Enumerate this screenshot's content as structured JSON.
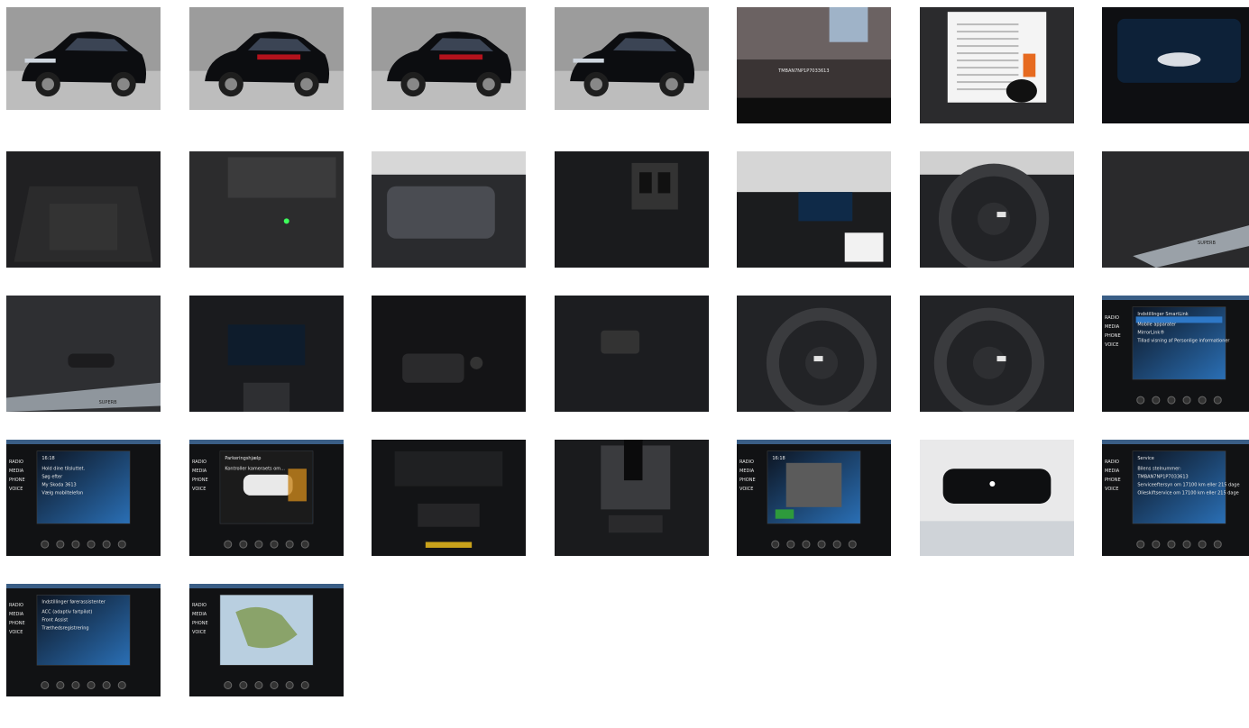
{
  "gallery": {
    "photos": [
      {
        "icon": "car-front-left-photo",
        "h": 114,
        "scene": "car-ext-fl"
      },
      {
        "icon": "car-rear-left-photo",
        "h": 114,
        "scene": "car-ext-rl"
      },
      {
        "icon": "car-rear-photo",
        "h": 114,
        "scene": "car-ext-r"
      },
      {
        "icon": "car-front-photo",
        "h": 114,
        "scene": "car-ext-f"
      },
      {
        "icon": "vin-plate-photo",
        "h": 129,
        "scene": "vin",
        "text": "TMBAN7NP1P7033613"
      },
      {
        "icon": "documents-and-keys-photo",
        "h": 129,
        "scene": "docs"
      },
      {
        "icon": "digital-cockpit-photo",
        "h": 129,
        "scene": "cockpit"
      },
      {
        "icon": "trunk-photo",
        "h": 129,
        "scene": "trunk"
      },
      {
        "icon": "trunk-sill-photo",
        "h": 129,
        "scene": "sill"
      },
      {
        "icon": "rear-seats-photo",
        "h": 129,
        "scene": "rearseat"
      },
      {
        "icon": "rear-vents-photo",
        "h": 129,
        "scene": "rearvent"
      },
      {
        "icon": "dashboard-photo",
        "h": 129,
        "scene": "dash"
      },
      {
        "icon": "steering-wheel-photo",
        "h": 129,
        "scene": "wheel"
      },
      {
        "icon": "door-sill-photo",
        "h": 129,
        "scene": "doorsill",
        "text": "SUPERB"
      },
      {
        "icon": "seat-controls-photo",
        "h": 129,
        "scene": "seatctl",
        "text": "SUPERB"
      },
      {
        "icon": "center-console-photo",
        "h": 129,
        "scene": "console"
      },
      {
        "icon": "window-switches-photo",
        "h": 129,
        "scene": "winsw"
      },
      {
        "icon": "light-switch-photo",
        "h": 129,
        "scene": "lightsw"
      },
      {
        "icon": "steering-left-buttons-photo",
        "h": 129,
        "scene": "wheelL"
      },
      {
        "icon": "steering-right-buttons-photo",
        "h": 129,
        "scene": "wheelR"
      },
      {
        "icon": "infotainment-smartlink-photo",
        "h": 129,
        "scene": "screen-smartlink",
        "screen": {
          "title": "Indstillinger SmartLink",
          "lines": [
            "Mobile apparater",
            "MirrorLink®",
            "Tillad visning af Personlige informationer"
          ]
        }
      },
      {
        "icon": "infotainment-phone-photo",
        "h": 129,
        "scene": "screen-phone",
        "screen": {
          "title": "16:18",
          "lines": [
            "Hold dine tilsluttet.",
            "Søg efter",
            "My Skoda 3613",
            "Vælg mobiltelefon"
          ]
        }
      },
      {
        "icon": "infotainment-parking-photo",
        "h": 129,
        "scene": "screen-park",
        "screen": {
          "title": "Parkeringshjælp",
          "lines": [
            "Kontroller kameraets om..."
          ]
        }
      },
      {
        "icon": "climate-controls-photo",
        "h": 129,
        "scene": "climate"
      },
      {
        "icon": "gear-selector-photo",
        "h": 129,
        "scene": "gear"
      },
      {
        "icon": "infotainment-car-photo",
        "h": 129,
        "scene": "screen-car",
        "screen": {
          "title": "16:18",
          "lines": []
        }
      },
      {
        "icon": "rear-view-mirror-photo",
        "h": 129,
        "scene": "mirror"
      },
      {
        "icon": "infotainment-service-photo",
        "h": 129,
        "scene": "screen-service",
        "screen": {
          "title": "Service",
          "lines": [
            "Bilens stelnummer:",
            "TMBAN7NP1P7033613",
            "Serviceeftersyn om 17100 km eller 215 dage",
            "Olieskiftservice om 17100 km eller 215 dage"
          ]
        }
      },
      {
        "icon": "infotainment-assist-photo",
        "h": 125,
        "scene": "screen-assist",
        "screen": {
          "title": "Indstillinger førerassistenter",
          "lines": [
            "ACC (adaptiv fartpilot)",
            "Front Assist",
            "Træthedsregistrering"
          ]
        }
      },
      {
        "icon": "infotainment-map-photo",
        "h": 125,
        "scene": "screen-map",
        "screen": {
          "title": "",
          "lines": []
        }
      }
    ],
    "menu_labels": [
      "RADIO",
      "MEDIA",
      "PHONE",
      "VOICE"
    ]
  },
  "colors": {
    "page_bg": "#ffffff",
    "studio_bg": "#9a9a9a",
    "car_body": "#0c0d10",
    "screen_blue": "#2a6fb5",
    "interior_dark": "#1a1a1c"
  }
}
